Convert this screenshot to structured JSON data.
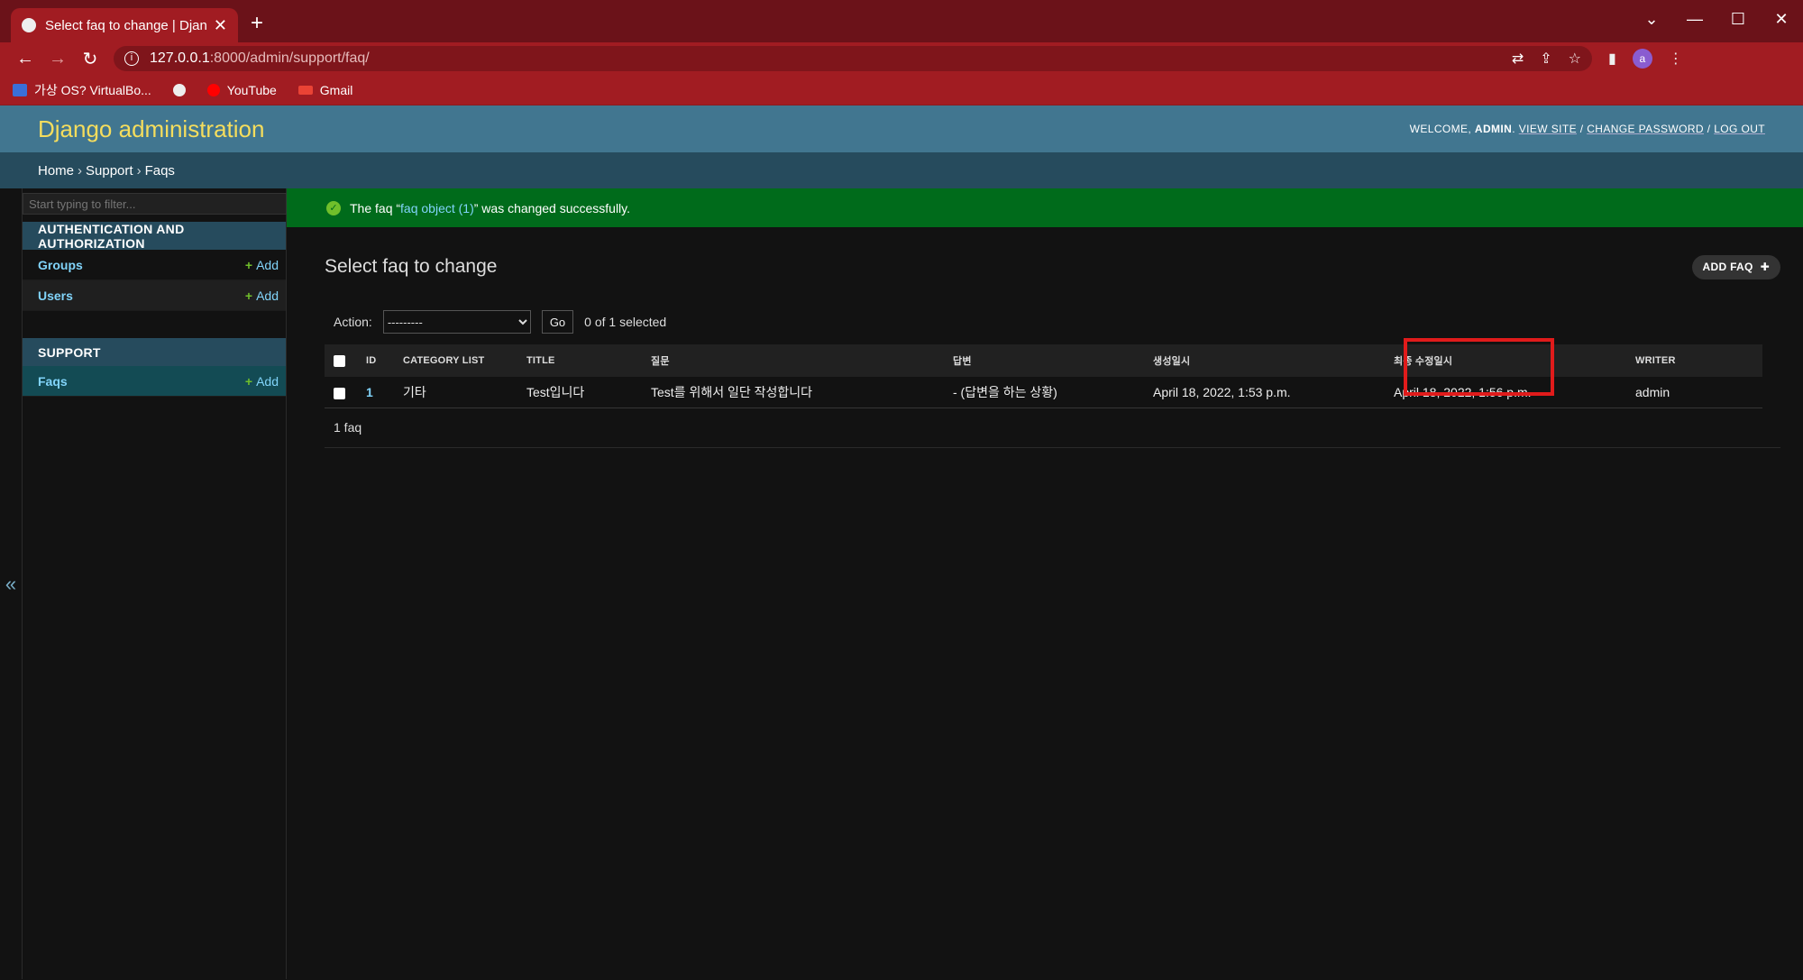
{
  "browser": {
    "tab_title": "Select faq to change | Django s",
    "url_host": "127.0.0.1",
    "url_path": ":8000/admin/support/faq/",
    "avatar_letter": "a",
    "bookmarks": [
      "가상 OS? VirtualBo...",
      "YouTube",
      "Gmail"
    ]
  },
  "header": {
    "brand": "Django administration",
    "welcome": "WELCOME, ",
    "user": "ADMIN",
    "view_site": "VIEW SITE",
    "change_password": "CHANGE PASSWORD",
    "log_out": "LOG OUT"
  },
  "breadcrumbs": [
    "Home",
    "Support",
    "Faqs"
  ],
  "sidebar": {
    "filter_placeholder": "Start typing to filter...",
    "modules": [
      {
        "title": "AUTHENTICATION AND AUTHORIZATION",
        "items": [
          {
            "name": "Groups",
            "add": "Add"
          },
          {
            "name": "Users",
            "add": "Add"
          }
        ]
      },
      {
        "title": "SUPPORT",
        "items": [
          {
            "name": "Faqs",
            "add": "Add"
          }
        ]
      }
    ]
  },
  "message": {
    "prefix": "The faq “",
    "link": "faq object (1)",
    "suffix": "” was changed successfully."
  },
  "page": {
    "title": "Select faq to change",
    "add_button": "ADD FAQ",
    "action_label": "Action:",
    "action_default": "---------",
    "go": "Go",
    "selected": "0 of 1 selected",
    "paginator": "1 faq"
  },
  "table": {
    "headers": [
      "ID",
      "CATEGORY LIST",
      "TITLE",
      "질문",
      "답변",
      "생성일시",
      "최종 수정일시",
      "WRITER"
    ],
    "rows": [
      [
        "1",
        "기타",
        "Test입니다",
        "Test를 위해서 일단 작성합니다",
        "- (답변을 하는 상황)",
        "April 18, 2022, 1:53 p.m.",
        "April 18, 2022, 1:56 p.m.",
        "admin"
      ]
    ]
  },
  "colors": {
    "highlight": "#e01b1b",
    "header_bg": "#417690",
    "brand": "#f5dd5d",
    "success": "#006b1b"
  }
}
